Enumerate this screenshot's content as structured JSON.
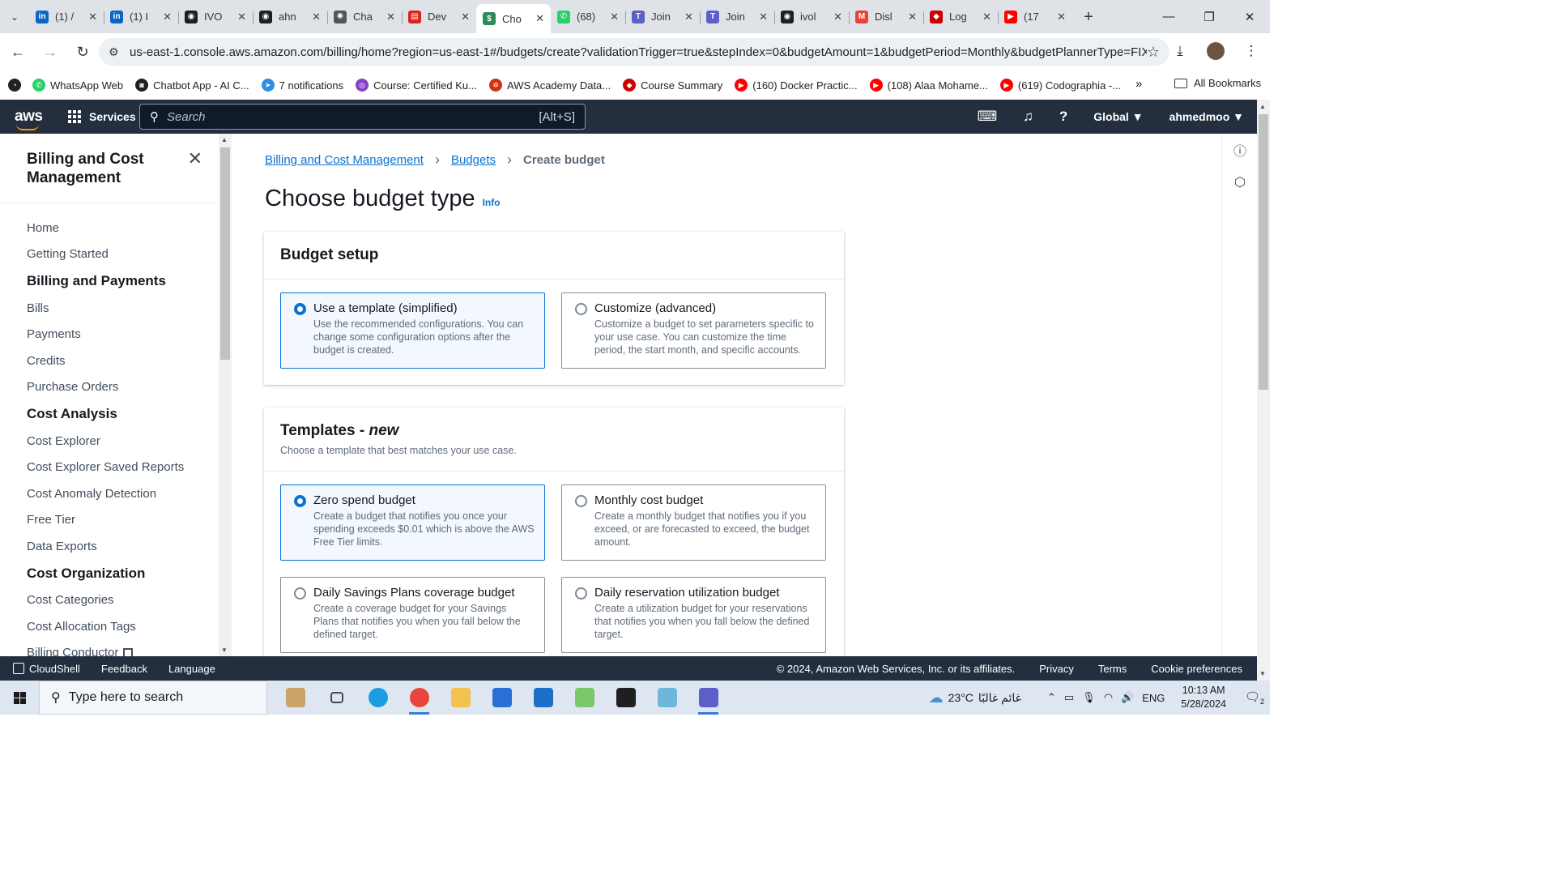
{
  "browser": {
    "tabs": [
      {
        "title": "(1) /",
        "icon": "linkedin-icon",
        "color": "#0a66c2",
        "glyph": "in"
      },
      {
        "title": "(1) I",
        "icon": "linkedin-icon",
        "color": "#0a66c2",
        "glyph": "in"
      },
      {
        "title": "IVO",
        "icon": "github-icon",
        "color": "#1f1f1f",
        "glyph": "◉"
      },
      {
        "title": "ahn",
        "icon": "github-icon",
        "color": "#1f1f1f",
        "glyph": "◉"
      },
      {
        "title": "Cha",
        "icon": "chatgpt-icon",
        "color": "#555555",
        "glyph": "✺"
      },
      {
        "title": "Dev",
        "icon": "document-icon",
        "color": "#d9261c",
        "glyph": "▤"
      },
      {
        "title": "Cho",
        "icon": "billing-icon",
        "color": "#2e8b57",
        "glyph": "$",
        "active": true
      },
      {
        "title": "(68)",
        "icon": "whatsapp-icon",
        "color": "#25d366",
        "glyph": "✆"
      },
      {
        "title": "Join",
        "icon": "teams-icon",
        "color": "#5b5fc7",
        "glyph": "T"
      },
      {
        "title": "Join",
        "icon": "teams-icon",
        "color": "#5b5fc7",
        "glyph": "T"
      },
      {
        "title": "ivol",
        "icon": "github-icon",
        "color": "#1f1f1f",
        "glyph": "◉"
      },
      {
        "title": "Disl",
        "icon": "gmail-icon",
        "color": "#ea4335",
        "glyph": "M"
      },
      {
        "title": "Log",
        "icon": "redhat-icon",
        "color": "#cc0000",
        "glyph": "◆"
      },
      {
        "title": "(17",
        "icon": "youtube-icon",
        "color": "#ff0000",
        "glyph": "▶"
      }
    ],
    "url": "us-east-1.console.aws.amazon.com/billing/home?region=us-east-1#/budgets/create?validationTrigger=true&stepIndex=0&budgetAmount=1&budgetPeriod=Monthly&budgetPlannerType=FIXED...",
    "bookmarks": [
      {
        "label": "",
        "color": "#222222",
        "glyph": "◔"
      },
      {
        "label": "WhatsApp Web",
        "color": "#25d366",
        "glyph": "✆"
      },
      {
        "label": "Chatbot App - AI C...",
        "color": "#1f1f1f",
        "glyph": "◙"
      },
      {
        "label": "7 notifications",
        "color": "#2f8de4",
        "glyph": "➤"
      },
      {
        "label": "Course: Certified Ku...",
        "color": "#8b3fc7",
        "glyph": "◎"
      },
      {
        "label": "AWS Academy Data...",
        "color": "#d13212",
        "glyph": "✲"
      },
      {
        "label": "Course Summary",
        "color": "#cc0000",
        "glyph": "◆"
      },
      {
        "label": "(160) Docker Practic...",
        "color": "#ff0000",
        "glyph": "▶"
      },
      {
        "label": "(108) Alaa Mohame...",
        "color": "#ff0000",
        "glyph": "▶"
      },
      {
        "label": "(619) Codographia -...",
        "color": "#ff0000",
        "glyph": "▶"
      }
    ],
    "all_bookmarks": "All Bookmarks"
  },
  "aws_nav": {
    "logo": "aws",
    "services": "Services",
    "search_placeholder": "Search",
    "search_shortcut": "[Alt+S]",
    "region": "Global ▼",
    "account": "ahmedmoo ▼"
  },
  "sidenav": {
    "title": "Billing and Cost Management",
    "items": [
      {
        "label": "Home",
        "type": "item"
      },
      {
        "label": "Getting Started",
        "type": "item"
      },
      {
        "label": "Billing and Payments",
        "type": "section"
      },
      {
        "label": "Bills",
        "type": "item"
      },
      {
        "label": "Payments",
        "type": "item"
      },
      {
        "label": "Credits",
        "type": "item"
      },
      {
        "label": "Purchase Orders",
        "type": "item"
      },
      {
        "label": "Cost Analysis",
        "type": "section"
      },
      {
        "label": "Cost Explorer",
        "type": "item"
      },
      {
        "label": "Cost Explorer Saved Reports",
        "type": "item"
      },
      {
        "label": "Cost Anomaly Detection",
        "type": "item"
      },
      {
        "label": "Free Tier",
        "type": "item"
      },
      {
        "label": "Data Exports",
        "type": "item"
      },
      {
        "label": "Cost Organization",
        "type": "section"
      },
      {
        "label": "Cost Categories",
        "type": "item"
      },
      {
        "label": "Cost Allocation Tags",
        "type": "item"
      },
      {
        "label": "Billing Conductor",
        "type": "item",
        "external": true
      }
    ]
  },
  "main": {
    "breadcrumbs": [
      "Billing and Cost Management",
      "Budgets",
      "Create budget"
    ],
    "title": "Choose budget type",
    "info": "Info",
    "budget_setup": {
      "heading": "Budget setup",
      "options": [
        {
          "title": "Use a template (simplified)",
          "desc": "Use the recommended configurations. You can change some configuration options after the budget is created.",
          "selected": true
        },
        {
          "title": "Customize (advanced)",
          "desc": "Customize a budget to set parameters specific to your use case. You can customize the time period, the start month, and specific accounts.",
          "selected": false
        }
      ]
    },
    "templates": {
      "heading": "Templates - ",
      "heading_em": "new",
      "description": "Choose a template that best matches your use case.",
      "options": [
        {
          "title": "Zero spend budget",
          "desc": "Create a budget that notifies you once your spending exceeds $0.01 which is above the AWS Free Tier limits.",
          "selected": true
        },
        {
          "title": "Monthly cost budget",
          "desc": "Create a monthly budget that notifies you if you exceed, or are forecasted to exceed, the budget amount.",
          "selected": false
        },
        {
          "title": "Daily Savings Plans coverage budget",
          "desc": "Create a coverage budget for your Savings Plans that notifies you when you fall below the defined target.",
          "selected": false
        },
        {
          "title": "Daily reservation utilization budget",
          "desc": "Create a utilization budget for your reservations that notifies you when you fall below the defined target.",
          "selected": false
        }
      ]
    }
  },
  "footer": {
    "cloudshell": "CloudShell",
    "feedback": "Feedback",
    "language": "Language",
    "copyright": "© 2024, Amazon Web Services, Inc. or its affiliates.",
    "privacy": "Privacy",
    "terms": "Terms",
    "cookies": "Cookie preferences"
  },
  "taskbar": {
    "search_placeholder": "Type here to search",
    "apps": [
      {
        "name": "village-widget-icon",
        "color": "#c9a36a"
      },
      {
        "name": "task-view-icon",
        "color": "#4a4a4a"
      },
      {
        "name": "edge-icon",
        "color": "#1b9de2"
      },
      {
        "name": "chrome-icon",
        "color": "#e8453c",
        "open": true
      },
      {
        "name": "file-explorer-icon",
        "color": "#f2c14e"
      },
      {
        "name": "microsoft-store-icon",
        "color": "#2b6fd6"
      },
      {
        "name": "mail-icon",
        "color": "#1e6fc9"
      },
      {
        "name": "gitkraken-icon",
        "color": "#7bc86c"
      },
      {
        "name": "terminal-icon",
        "color": "#1f1f1f"
      },
      {
        "name": "notepad-icon",
        "color": "#6fb7d9"
      },
      {
        "name": "teams-icon",
        "color": "#5b5fc7",
        "open": true
      }
    ],
    "weather": "23°C",
    "weather_desc": "غائم غالبًا",
    "language": "ENG",
    "time": "10:13 AM",
    "date": "5/28/2024",
    "notifications": "2"
  }
}
